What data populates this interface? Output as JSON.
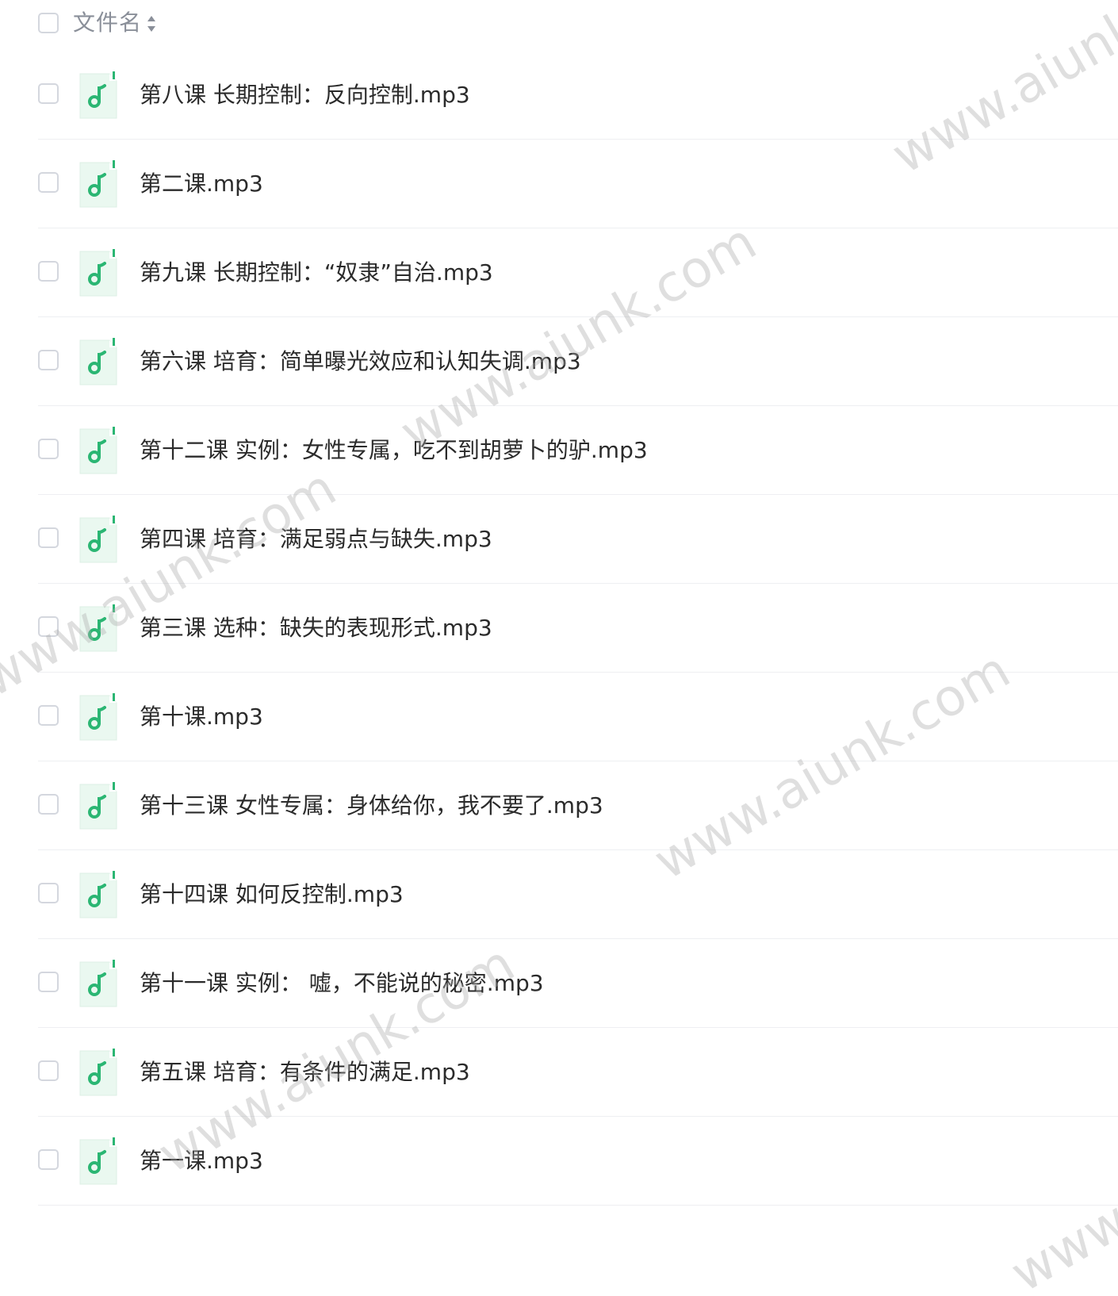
{
  "header": {
    "column_label": "文件名"
  },
  "files": [
    {
      "name": "第八课 长期控制：反向控制.mp3"
    },
    {
      "name": "第二课.mp3"
    },
    {
      "name": "第九课 长期控制：“奴隶”自治.mp3"
    },
    {
      "name": "第六课 培育：简单曝光效应和认知失调.mp3"
    },
    {
      "name": "第十二课 实例：女性专属，吃不到胡萝卜的驴.mp3"
    },
    {
      "name": "第四课 培育：满足弱点与缺失.mp3"
    },
    {
      "name": "第三课 选种：缺失的表现形式.mp3"
    },
    {
      "name": "第十课.mp3"
    },
    {
      "name": "第十三课 女性专属：身体给你，我不要了.mp3"
    },
    {
      "name": "第十四课 如何反控制.mp3"
    },
    {
      "name": "第十一课 实例： 嘘，不能说的秘密.mp3"
    },
    {
      "name": "第五课 培育：有条件的满足.mp3"
    },
    {
      "name": "第一课.mp3"
    }
  ],
  "watermarks": [
    {
      "text": "www.aiunk.com"
    },
    {
      "text": "www.aiunk.com"
    },
    {
      "text": "www.aiunk.com"
    },
    {
      "text": "www.aiunk.com"
    },
    {
      "text": "www.aiunk.com"
    },
    {
      "text": "www.aiunk.com"
    }
  ],
  "colors": {
    "audio_icon_green": "#2bb673",
    "file_icon_bg": "#eaf8f0",
    "checkbox_border": "#d4d7de",
    "divider": "#eeeff2",
    "header_text": "#8a8f99"
  },
  "icons": {
    "file_type": "music-note-icon",
    "sort": "sort-icon"
  }
}
